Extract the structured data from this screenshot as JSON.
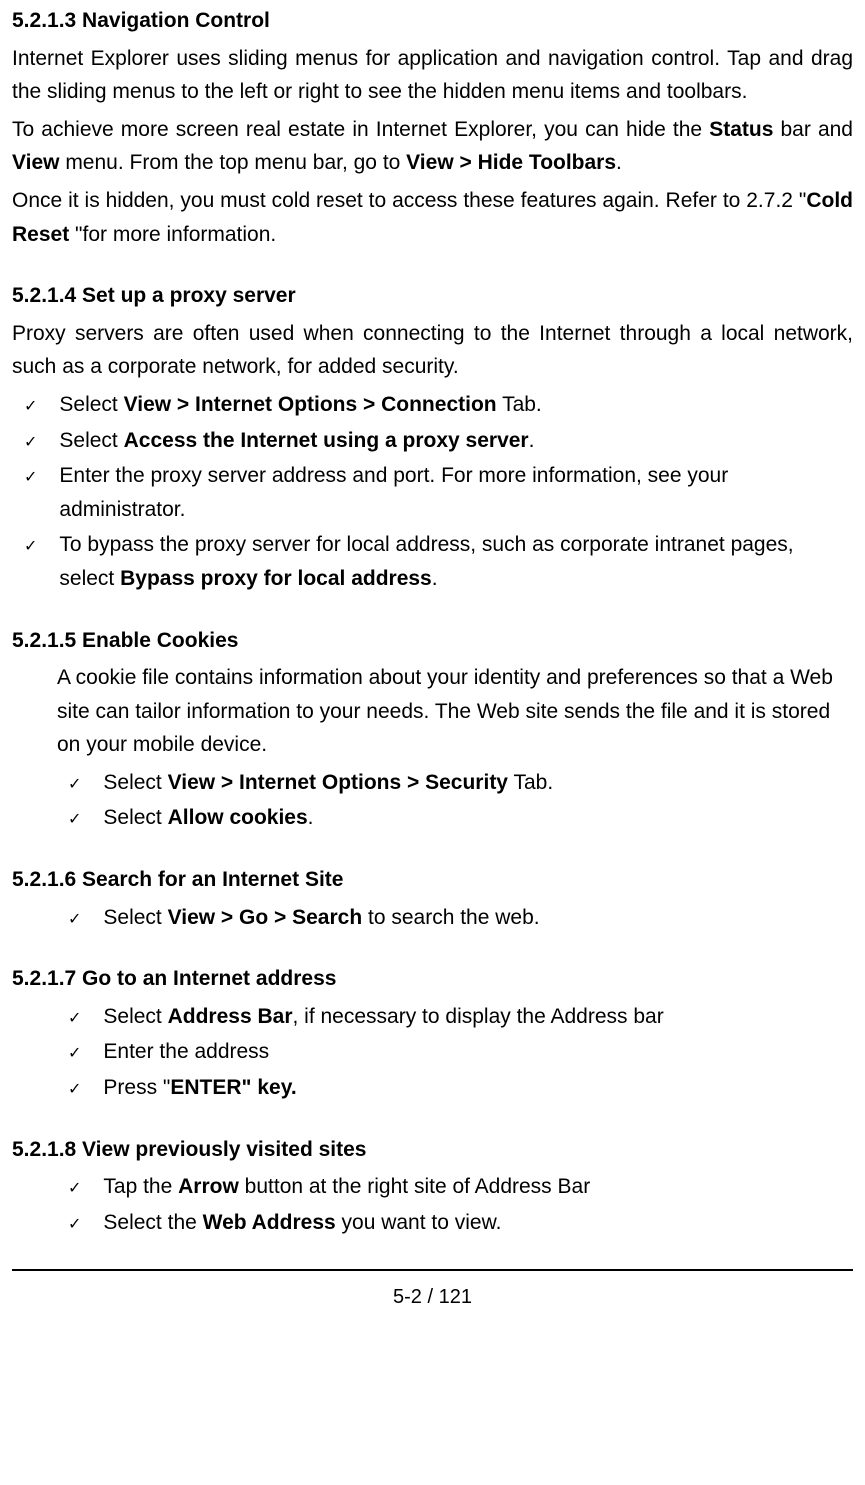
{
  "sec1": {
    "title": "5.2.1.3 Navigation Control",
    "p1_a": "Internet Explorer uses sliding menus for application and navigation control. Tap and drag the sliding menus to the left or right to see the hidden menu items and toolbars.",
    "p2_a": "To achieve more screen real estate in Internet Explorer, you can hide the ",
    "p2_b": "Status",
    "p2_c": " bar and ",
    "p2_d": "View",
    "p2_e": " menu. From the top menu bar, go to ",
    "p2_f": "View > Hide Toolbars",
    "p2_g": ".",
    "p3_a": "Once it is hidden, you must cold reset to access these features again. Refer to 2.7.2 \"",
    "p3_b": "Cold Reset",
    "p3_c": " \"for more information."
  },
  "sec2": {
    "title": "5.2.1.4 Set up a proxy server",
    "p1": "Proxy servers are often used when connecting to the Internet through a local network, such as a corporate network, for added security.",
    "i1_a": "Select ",
    "i1_b": "View > Internet Options > Connection",
    "i1_c": " Tab.",
    "i2_a": "Select ",
    "i2_b": "Access the Internet using a proxy server",
    "i2_c": ".",
    "i3": "Enter the proxy server address and port. For more information, see your administrator.",
    "i4_a": "To bypass the proxy server for local address, such as corporate intranet pages, select ",
    "i4_b": "Bypass proxy for local address",
    "i4_c": "."
  },
  "sec3": {
    "title": "5.2.1.5 Enable Cookies",
    "p1": "A cookie file contains information about your identity and preferences so that a Web site can tailor information to your needs. The Web site sends the file and it is stored on your mobile device.",
    "i1_a": "Select ",
    "i1_b": "View > Internet Options > Security",
    "i1_c": " Tab.",
    "i2_a": "Select ",
    "i2_b": "Allow cookies",
    "i2_c": "."
  },
  "sec4": {
    "title": "5.2.1.6 Search for an Internet Site",
    "i1_a": "Select ",
    "i1_b": "View > Go > Search",
    "i1_c": " to search the web."
  },
  "sec5": {
    "title": "5.2.1.7 Go to an Internet address",
    "i1_a": "Select ",
    "i1_b": "Address Bar",
    "i1_c": ", if necessary to display the Address bar",
    "i2": "Enter the address",
    "i3_a": "Press \"",
    "i3_b": "ENTER\" key."
  },
  "sec6": {
    "title": "5.2.1.8 View previously visited sites",
    "i1_a": "Tap the ",
    "i1_b": "Arrow",
    "i1_c": " button at the right site of Address Bar",
    "i2_a": "Select the ",
    "i2_b": "Web Address",
    "i2_c": " you want to view."
  },
  "footer": "5-2 / 121",
  "check": "✓"
}
